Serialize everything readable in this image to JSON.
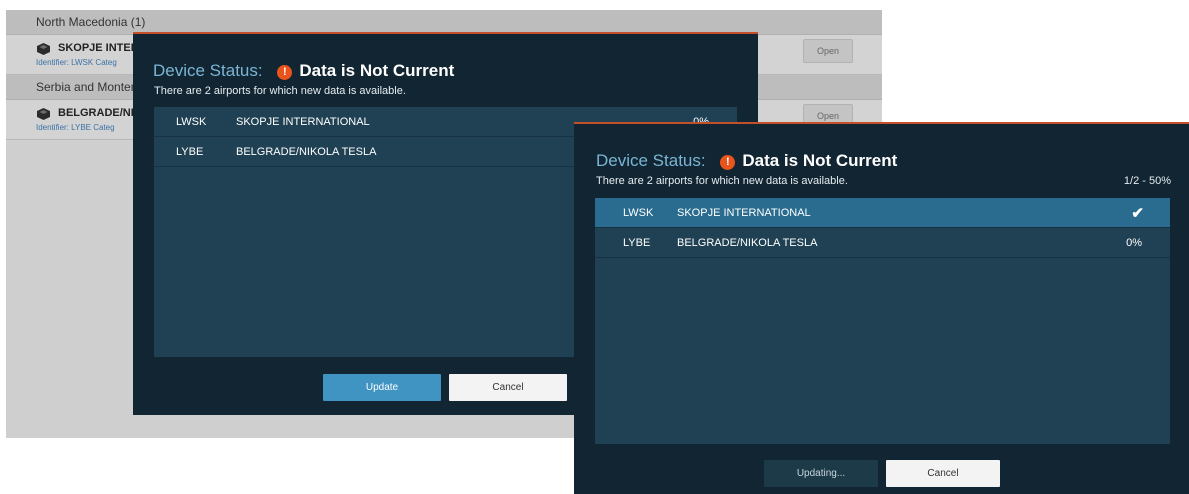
{
  "background_list": {
    "groups": [
      {
        "header": "North Macedonia (1)",
        "airport": {
          "name": "SKOPJE INTER",
          "meta": "Identifier: LWSK   Categ",
          "open_label": "Open"
        }
      },
      {
        "header": "Serbia and Montene",
        "airport": {
          "name": "BELGRADE/NIK",
          "meta": "Identifier: LYBE   Categ",
          "open_label": "Open"
        }
      }
    ]
  },
  "dialog_before": {
    "title_label": "Device Status:",
    "status": "Data is Not Current",
    "subtitle": "There are 2 airports for which new data is available.",
    "rows": [
      {
        "ident": "LWSK",
        "name": "SKOPJE INTERNATIONAL",
        "progress": "0%"
      },
      {
        "ident": "LYBE",
        "name": "BELGRADE/NIKOLA TESLA",
        "progress": ""
      }
    ],
    "primary_button": "Update",
    "secondary_button": "Cancel"
  },
  "dialog_after": {
    "title_label": "Device Status:",
    "status": "Data is Not Current",
    "subtitle": "There are 2 airports for which new data is available.",
    "overall_progress": "1/2 - 50%",
    "rows": [
      {
        "ident": "LWSK",
        "name": "SKOPJE INTERNATIONAL",
        "progress": "",
        "done": true
      },
      {
        "ident": "LYBE",
        "name": "BELGRADE/NIKOLA TESLA",
        "progress": "0%",
        "done": false
      }
    ],
    "primary_button": "Updating...",
    "secondary_button": "Cancel"
  },
  "icons": {
    "warning": "exclamation-warning-icon",
    "check": "checkmark-icon",
    "airport_pin": "airport-pin-icon"
  },
  "colors": {
    "accent": "#c2512b",
    "warning": "#e8541c",
    "title_blue": "#7ab5d4",
    "selected_row": "#2a6c8f",
    "dialog_bg": "#122532"
  }
}
